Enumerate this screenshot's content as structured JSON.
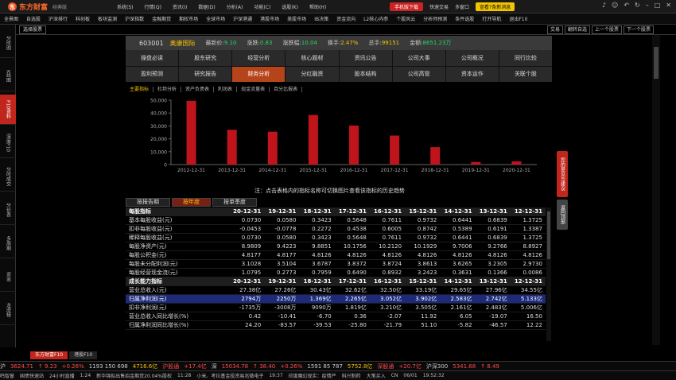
{
  "app": {
    "logo": "东方财富",
    "edition": "经典版"
  },
  "menu": [
    "系统(S)",
    "行情(Q)",
    "资讯(I)",
    "数据(D)",
    "分析(A)",
    "功能(C)",
    "选股(K)",
    "帮助(H)"
  ],
  "title_right": {
    "download": "手机版下载",
    "trade": "快速交易",
    "manage": "多窗口",
    "promo": "宣看?条新消息"
  },
  "nav": [
    "全景图",
    "自选股",
    "沪深排行",
    "科创板",
    "板块监测",
    "沪深指数",
    "金融期货",
    "期权市场",
    "全球市场",
    "沪深港通",
    "港股市场",
    "美股市场",
    "IB决策",
    "资金流向",
    "L2核心内参",
    "个股风云",
    "分析师预测",
    "条件选股",
    "打开导航",
    "退出F10"
  ],
  "tab_left": "选择股票",
  "right_buttons": [
    "交易",
    "翻转自选",
    "上一个股票",
    "下一个股票"
  ],
  "left_tabs": [
    "分时图",
    "K线图",
    "F10资料",
    "深度F10",
    "分时成交",
    "分价表",
    "多周期",
    "资金",
    "龙虎榜"
  ],
  "stock": {
    "code": "603001",
    "name": "奥康国际",
    "price_label": "最新价:",
    "price": "9.10",
    "chg_label": "涨跌:",
    "chg": "0.83",
    "pct_label": "涨跌幅:",
    "pct": "10.04",
    "turn_label": "换手:",
    "turn": "2.47%",
    "vol_label": "总手:",
    "vol": "99151",
    "amt_label": "金额:",
    "amt": "8651.23万"
  },
  "func_buttons": [
    "操盘必读",
    "股东研究",
    "经营分析",
    "核心题材",
    "资讯公告",
    "公司大事",
    "公司概况",
    "同行比较",
    "盈利预测",
    "研究报告",
    "财务分析",
    "分红融资",
    "股本结构",
    "公司高管",
    "资本运作",
    "关联个股"
  ],
  "sub_tabs": [
    "主要指标",
    "杜邦分析",
    "资产负债表",
    "利润表",
    "现金流量表",
    "百分比报表"
  ],
  "chart_data": {
    "type": "bar",
    "categories": [
      "2012-12-31",
      "2013-12-31",
      "2014-12-31",
      "2015-12-31",
      "2016-12-31",
      "2017-12-31",
      "2018-12-31",
      "2019-12-31",
      "2020-12-31"
    ],
    "values": [
      49500,
      27000,
      25500,
      38500,
      30300,
      22500,
      13500,
      2000,
      2500
    ],
    "ylim": [
      0,
      50000
    ],
    "yticks": [
      "50,000",
      "40,000",
      "30,000",
      "20,000",
      "10,000",
      "0"
    ],
    "bar_color": "#c0141c",
    "grid": false
  },
  "note": "注：点击表格内的指标名称可切换图片查看该指标的历史趋势",
  "period_tabs": [
    "按报告期",
    "按年度",
    "按单季度"
  ],
  "table": {
    "columns": [
      "20-12-31",
      "19-12-31",
      "18-12-31",
      "17-12-31",
      "16-12-31",
      "15-12-31",
      "14-12-31",
      "13-12-31",
      "12-12-31"
    ],
    "rows": [
      {
        "label": "每股指标",
        "cells": [
          "20-12-31",
          "19-12-31",
          "18-12-31",
          "17-12-31",
          "16-12-31",
          "15-12-31",
          "14-12-31",
          "13-12-31",
          "12-12-31"
        ],
        "type": "head"
      },
      {
        "label": "基本每股收益(元)",
        "cells": [
          "0.0730",
          "0.0580",
          "0.3423",
          "0.5648",
          "0.7611",
          "0.9732",
          "0.6441",
          "0.6839",
          "1.3725"
        ]
      },
      {
        "label": "扣非每股收益(元)",
        "cells": [
          "-0.0453",
          "-0.0778",
          "0.2272",
          "0.4538",
          "0.6005",
          "0.8742",
          "0.5389",
          "0.6191",
          "1.3387"
        ]
      },
      {
        "label": "稀释每股收益(元)",
        "cells": [
          "0.0730",
          "0.0580",
          "0.3423",
          "0.5648",
          "0.7611",
          "0.9732",
          "0.6441",
          "0.6839",
          "1.3725"
        ]
      },
      {
        "label": "每股净资产(元)",
        "cells": [
          "8.9809",
          "9.4223",
          "9.8851",
          "10.1756",
          "10.2120",
          "10.1929",
          "9.7006",
          "9.2766",
          "8.8927"
        ]
      },
      {
        "label": "每股公积金(元)",
        "cells": [
          "4.8177",
          "4.8177",
          "4.8126",
          "4.8126",
          "4.8126",
          "4.8126",
          "4.8126",
          "4.8126",
          "4.8126"
        ]
      },
      {
        "label": "每股未分配利润(元)",
        "cells": [
          "3.1028",
          "3.5104",
          "3.6787",
          "3.8372",
          "3.8724",
          "3.8613",
          "3.6265",
          "3.2305",
          "2.9730"
        ]
      },
      {
        "label": "每股经营现金流(元)",
        "cells": [
          "1.0795",
          "0.2773",
          "0.7959",
          "0.6490",
          "0.8932",
          "3.2423",
          "0.3631",
          "0.1366",
          "0.0086"
        ]
      },
      {
        "label": "成长能力指标",
        "cells": [
          "20-12-31",
          "19-12-31",
          "18-12-31",
          "17-12-31",
          "16-12-31",
          "15-12-31",
          "14-12-31",
          "13-12-31",
          "12-12-31"
        ],
        "type": "head"
      },
      {
        "label": "营业总收入(元)",
        "cells": [
          "27.38亿",
          "27.26亿",
          "30.43亿",
          "32.62亿",
          "32.50亿",
          "33.19亿",
          "29.65亿",
          "27.96亿",
          "34.55亿"
        ]
      },
      {
        "label": "归属净利润(元)",
        "cells": [
          "2794万",
          "2250万",
          "1.369亿",
          "2.265亿",
          "3.052亿",
          "3.902亿",
          "2.583亿",
          "2.742亿",
          "5.133亿"
        ],
        "type": "sel"
      },
      {
        "label": "扣非净利润(元)",
        "cells": [
          "-1735万",
          "-3008万",
          "9090万",
          "1.819亿",
          "3.210亿",
          "3.505亿",
          "2.161亿",
          "2.483亿",
          "5.006亿"
        ]
      },
      {
        "label": "营业总收入同比增长(%)",
        "cells": [
          "0.42",
          "-10.41",
          "-6.70",
          "0.36",
          "-2.07",
          "11.92",
          "6.05",
          "-19.07",
          "16.50"
        ]
      },
      {
        "label": "归属净利润同比增长(%)",
        "cells": [
          "24.20",
          "-83.57",
          "-39.53",
          "-25.80",
          "-21.79",
          "51.10",
          "-5.82",
          "-46.57",
          "12.22"
        ]
      }
    ]
  },
  "side_panel": {
    "feedback": "您的意见与建议",
    "scroll_top": "返回顶部"
  },
  "bottom_tabs": [
    "东方财富F10",
    "港股F10"
  ],
  "ticker": [
    {
      "t": "沪",
      "c": "#ccc"
    },
    {
      "t": "3624.71",
      "c": "#ff4a4a"
    },
    {
      "t": "↑ 9.23",
      "c": "#ff4a4a"
    },
    {
      "t": "+0.26%",
      "c": "#ff4a4a"
    },
    {
      "t": "1193 150 698",
      "c": "#ccc"
    },
    {
      "t": "4716.6亿",
      "c": "#f5c100"
    },
    {
      "t": "沪股通",
      "c": "#ff4a4a"
    },
    {
      "t": "+17.4亿",
      "c": "#ff4a4a"
    },
    {
      "t": "深",
      "c": "#ccc"
    },
    {
      "t": "15034.78",
      "c": "#ff4a4a"
    },
    {
      "t": "↑ 38.40",
      "c": "#ff4a4a"
    },
    {
      "t": "+0.26%",
      "c": "#ff4a4a"
    },
    {
      "t": "1591 85 787",
      "c": "#ccc"
    },
    {
      "t": "5752.8亿",
      "c": "#f5c100"
    },
    {
      "t": "深股通",
      "c": "#ff4a4a"
    },
    {
      "t": "+20.7亿",
      "c": "#ff4a4a"
    },
    {
      "t": "沪深300",
      "c": "#ccc"
    },
    {
      "t": "5341.68",
      "c": "#ff4a4a"
    },
    {
      "t": "↑ 8.49",
      "c": "#ff4a4a"
    }
  ],
  "status": [
    "鸣智窗",
    "国债快速站",
    "24小时直播",
    "1:24",
    "新华锦拟出售招金期货20.04%股权",
    "11:28",
    "小米、考拉基金投资易兆微电子",
    "19:37",
    "印度魔幻现实：疫情严",
    "科兴制药",
    "大笔买入",
    "CN",
    "06/01",
    "19:52:32"
  ]
}
